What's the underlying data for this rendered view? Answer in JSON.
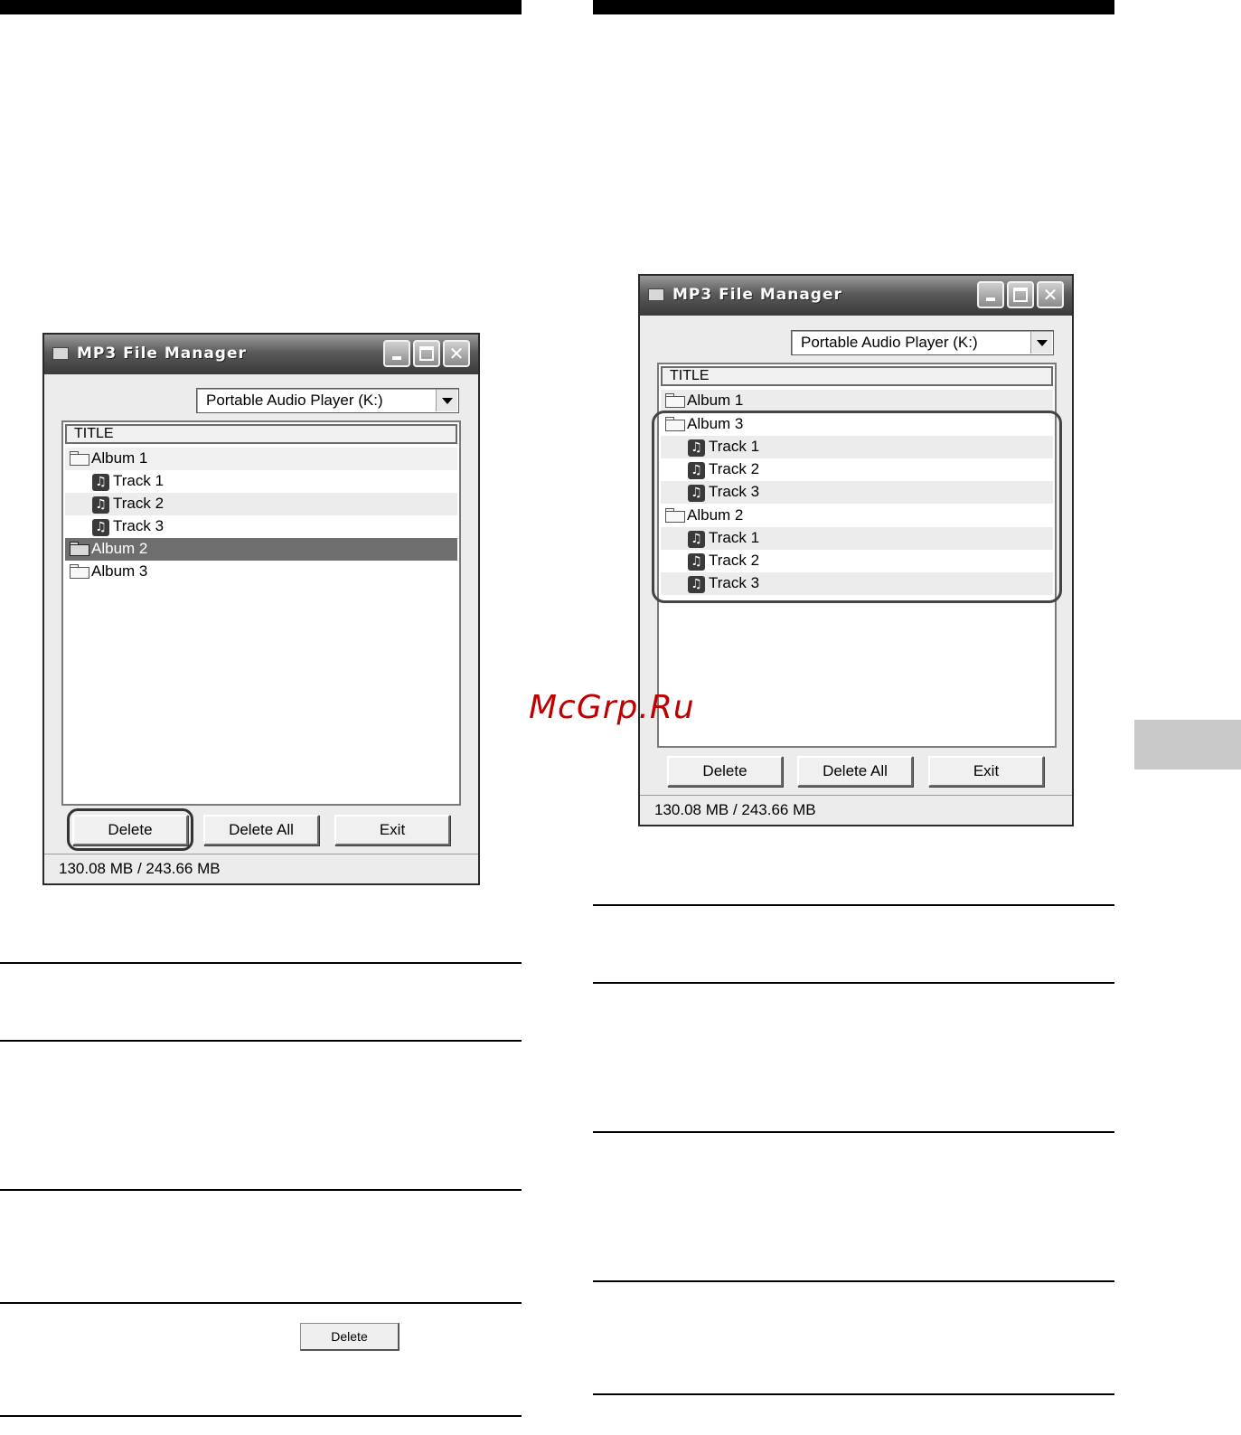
{
  "window_left": {
    "title": "MP3 File Manager",
    "drive_select": "Portable Audio Player (K:)",
    "column_header": "TITLE",
    "rows": [
      {
        "type": "folder",
        "label": "Album 1"
      },
      {
        "type": "track",
        "label": "Track 1"
      },
      {
        "type": "track",
        "label": "Track 2"
      },
      {
        "type": "track",
        "label": "Track 3"
      },
      {
        "type": "folder",
        "label": "Album 2",
        "selected": true
      },
      {
        "type": "folder",
        "label": "Album 3"
      }
    ],
    "buttons": {
      "delete": "Delete",
      "delete_all": "Delete All",
      "exit": "Exit"
    },
    "status": "130.08 MB / 243.66 MB"
  },
  "window_right": {
    "title": "MP3 File Manager",
    "drive_select": "Portable Audio Player (K:)",
    "column_header": "TITLE",
    "rows": [
      {
        "type": "folder",
        "label": "Album 1"
      },
      {
        "type": "folder",
        "label": "Album 3"
      },
      {
        "type": "track",
        "label": "Track 1"
      },
      {
        "type": "track",
        "label": "Track 2"
      },
      {
        "type": "track",
        "label": "Track 3"
      },
      {
        "type": "folder",
        "label": "Album 2"
      },
      {
        "type": "track",
        "label": "Track 1"
      },
      {
        "type": "track",
        "label": "Track 2"
      },
      {
        "type": "track",
        "label": "Track 3"
      }
    ],
    "buttons": {
      "delete": "Delete",
      "delete_all": "Delete All",
      "exit": "Exit"
    },
    "status": "130.08 MB / 243.66 MB"
  },
  "inline_button": "Delete",
  "watermark": "McGrp.Ru",
  "icons": {
    "folder": "folder-icon",
    "track": "music-note-icon",
    "app": "app-icon",
    "minimize": "minimize-icon",
    "maximize": "maximize-icon",
    "close": "close-icon",
    "dropdown": "chevron-down-icon"
  }
}
